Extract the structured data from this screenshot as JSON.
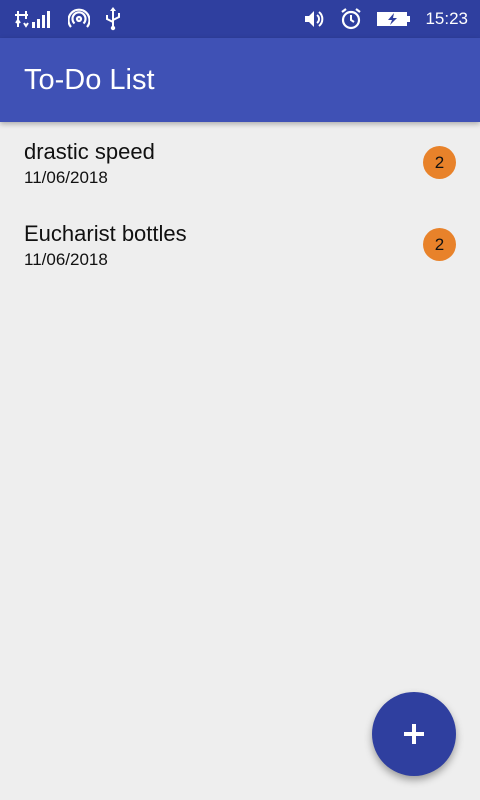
{
  "status_bar": {
    "time": "15:23",
    "icons": [
      "signal-icon",
      "hotspot-icon",
      "usb-icon",
      "volume-icon",
      "alarm-icon",
      "battery-charging-icon"
    ]
  },
  "app_bar": {
    "title": "To-Do List"
  },
  "todos": [
    {
      "title": "drastic speed",
      "date": "11/06/2018",
      "count": "2"
    },
    {
      "title": "Eucharist bottles",
      "date": "11/06/2018",
      "count": "2"
    }
  ],
  "fab": {
    "icon": "plus-icon"
  },
  "colors": {
    "status_bar": "#2f3f9f",
    "app_bar": "#3f51b5",
    "badge": "#e8822a",
    "fab": "#2f3f9f",
    "background": "#eeeeee"
  }
}
